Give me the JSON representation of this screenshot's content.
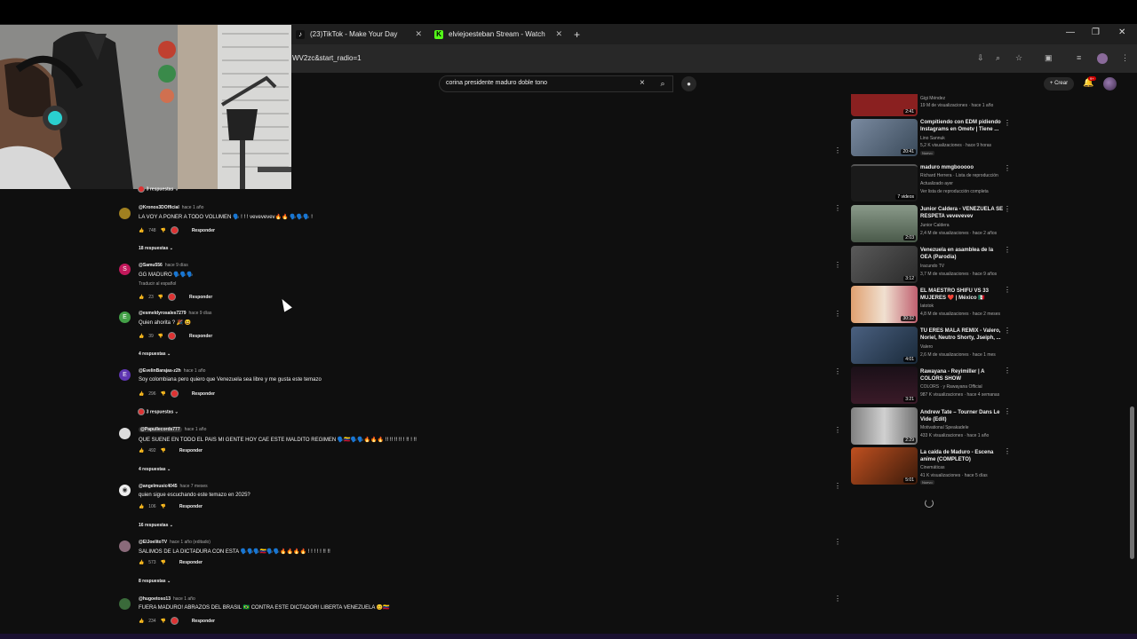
{
  "browser": {
    "tabs": [
      {
        "title": "(23)TikTok - Make Your Day",
        "icon": "tiktok-icon"
      },
      {
        "title": "elviejoesteban Stream - Watch",
        "icon": "kick-icon"
      }
    ],
    "new_tab": "+",
    "url": "WV2zc&start_radio=1",
    "window": {
      "minimize": "—",
      "restore": "❐",
      "close": "✕"
    }
  },
  "youtube": {
    "search_query": "corina presidente maduro doble tono",
    "create_label": "Crear",
    "notif_count": "9+"
  },
  "comments": [
    {
      "replies_label": "3 respuestas"
    },
    {
      "user": "@Kronos3DOfficial",
      "time": "hace 1 año",
      "text": "LA VOY A PONER A TODO VOLUMEN 🗣️ ! ! ! vevevevev🔥🔥 🗣️🗣️🗣️ !",
      "likes": "748",
      "reply": "Responder",
      "replies_label": "18 respuestas",
      "avatar_color": "#a08020",
      "avatar_letter": ""
    },
    {
      "user": "@Samu556",
      "time": "hace 9 días",
      "text": "GG MADURO 🗣️🗣️🗣️",
      "translate": "Traducir al español",
      "likes": "23",
      "reply": "Responder",
      "avatar_color": "#c2185b",
      "avatar_letter": "S"
    },
    {
      "user": "@esmeldyrosales7279",
      "time": "hace 9 días",
      "text": "Quien ahorita ? 🎉 😆",
      "likes": "39",
      "reply": "Responder",
      "replies_label": "4 respuestas",
      "avatar_color": "#43a047",
      "avatar_letter": "E"
    },
    {
      "user": "@EvelinBarajas-z2h",
      "time": "hace 1 año",
      "text": "Soy colombiana pero quiero que Venezuela sea libre y me gusta este temazo",
      "likes": "296",
      "reply": "Responder",
      "replies_label": "3 respuestas",
      "avatar_color": "#5e35b1",
      "avatar_letter": "E"
    },
    {
      "user": "@Papullecords777",
      "time": "hace 1 año",
      "text": "QUE SUENE EN TODO EL PAIS MI GENTE HOY CAE ESTE MALDITO REGIMEN 🗣️🇻🇪🗣️🗣️🔥🔥🔥 !! !! !! !! ! !! ! !!",
      "likes": "492",
      "reply": "Responder",
      "replies_label": "4 respuestas",
      "avatar_color": "#ddd",
      "avatar_letter": ""
    },
    {
      "user": "@angelmusic4045",
      "time": "hace 7 meses",
      "text": "quien sigue escuchando este temazo en 2025?",
      "likes": "106",
      "reply": "Responder",
      "replies_label": "16 respuestas",
      "avatar_color": "#eee",
      "avatar_letter": "◉"
    },
    {
      "user": "@ElJoelitoTV",
      "time": "hace 1 año (editado)",
      "text": "SALIMOS DE LA DICTADURA CON ESTA 🗣️🗣️🗣️🇻🇪🗣️🗣️🔥🔥🔥🔥 ! ! ! ! ! !! !!",
      "likes": "573",
      "reply": "Responder",
      "replies_label": "8 respuestas",
      "avatar_color": "#8a6a7a",
      "avatar_letter": ""
    },
    {
      "user": "@hugoetoso13",
      "time": "hace 1 año",
      "text": "FUERA MADURO! ABRAZOS DEL BRASIL 🇧🇷 CONTRA ESTE DICTADOR! LIBERTA VENEZUELA 😊🇻🇪",
      "likes": "234",
      "reply": "Responder",
      "avatar_color": "#3a6a3a",
      "avatar_letter": ""
    }
  ],
  "sidebar": [
    {
      "title": "",
      "channel": "Gigi Méndez",
      "meta": "19 M de visualizaciones · hace 1 año",
      "duration": "2:41",
      "thumb_color": "#8a2020"
    },
    {
      "title": "Compitiendo con EDM pidiendo Instagrams en Ometv | Tiene ...",
      "channel": "Lino Sannuk",
      "meta": "5,2 K visualizaciones · hace 9 horas",
      "badge": "Nuevo",
      "duration": "20:41",
      "thumb_color": "#5a6a80"
    },
    {
      "title": "maduro mmgbooooo",
      "channel": "Richard Herrera · Lista de reproducción",
      "meta": "Actualizado ayer",
      "extra": "Ver lista de reproducción completa",
      "duration": "7 videos",
      "thumb_color": "#2a2a2a"
    },
    {
      "title": "Junior Caldera - VENEZUELA SE RESPETA vevevevev",
      "channel": "Junior Caldera",
      "meta": "2,4 M de visualizaciones · hace 2 años",
      "duration": "2:03",
      "thumb_color": "#6a7a6a"
    },
    {
      "title": "Venezuela en asamblea de la OEA (Parodia)",
      "channel": "Iracundo TV",
      "meta": "3,7 M de visualizaciones · hace 9 años",
      "duration": "3:12",
      "thumb_color": "#4a4a4a"
    },
    {
      "title": "EL MAESTRO SHIFU VS 33 MUJERES ❤️ | México 🇲🇽",
      "channel": "Iatotok",
      "meta": "4,8 M de visualizaciones · hace 2 meses",
      "duration": "30:32",
      "thumb_color": "#c07a50"
    },
    {
      "title": "TU ERES MALA REMIX - Valero, Noriel, Neutro Shorty, Jseiph, ...",
      "channel": "Valero",
      "meta": "2,6 M de visualizaciones · hace 1 mes",
      "duration": "4:01",
      "thumb_color": "#3a5070"
    },
    {
      "title": "Rawayana - Reyimiller | A COLORS SHOW",
      "channel": "COLORS · y Rawayana Official",
      "meta": "987 K visualizaciones · hace 4 semanas",
      "duration": "3:21",
      "thumb_color": "#2a1a20"
    },
    {
      "title": "Andrew Tate – Tourner Dans Le Vide (Edit)",
      "channel": "Motivational Speakadele",
      "meta": "433 K visualizaciones · hace 1 año",
      "duration": "2:29",
      "thumb_color": "#606060"
    },
    {
      "title": "La caída de Maduro - Escena anime (COMPLETO)",
      "channel": "Cinemáticas",
      "meta": "41 K visualizaciones · hace 5 días",
      "badge": "Nuevo",
      "duration": "5:01",
      "thumb_color": "#7a3a10"
    }
  ],
  "colors": {
    "bg": "#0f0f0f",
    "accent": "#cc0000"
  }
}
